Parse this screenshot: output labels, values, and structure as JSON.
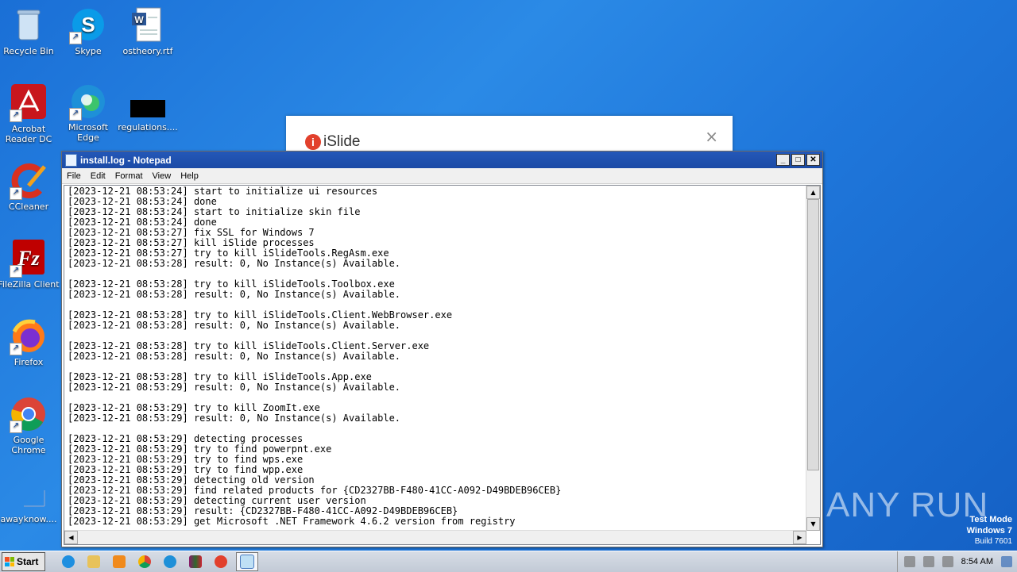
{
  "desktop": {
    "icons": [
      {
        "label": "Recycle Bin",
        "icon": "recycle-bin-icon"
      },
      {
        "label": "Skype",
        "icon": "skype-icon"
      },
      {
        "label": "ostheory.rtf",
        "icon": "word-document-icon"
      },
      {
        "label": "Acrobat Reader DC",
        "icon": "acrobat-icon"
      },
      {
        "label": "Microsoft Edge",
        "icon": "edge-icon"
      },
      {
        "label": "regulations....",
        "icon": "file-icon"
      },
      {
        "label": "CCleaner",
        "icon": "ccleaner-icon"
      },
      {
        "label": "FileZilla Client",
        "icon": "filezilla-icon"
      },
      {
        "label": "Firefox",
        "icon": "firefox-icon"
      },
      {
        "label": "Google Chrome",
        "icon": "chrome-icon"
      },
      {
        "label": "awayknow....",
        "icon": "file-icon"
      }
    ]
  },
  "islide": {
    "title": "iSlide",
    "close": "×"
  },
  "notepad": {
    "title": "install.log - Notepad",
    "menu": [
      "File",
      "Edit",
      "Format",
      "View",
      "Help"
    ],
    "lines": [
      "[2023-12-21 08:53:24] start to initialize ui resources",
      "[2023-12-21 08:53:24] done",
      "[2023-12-21 08:53:24] start to initialize skin file",
      "[2023-12-21 08:53:24] done",
      "[2023-12-21 08:53:27] fix SSL for Windows 7",
      "[2023-12-21 08:53:27] kill iSlide processes",
      "[2023-12-21 08:53:27] try to kill iSlideTools.RegAsm.exe",
      "[2023-12-21 08:53:28] result: 0, No Instance(s) Available.",
      "",
      "[2023-12-21 08:53:28] try to kill iSlideTools.Toolbox.exe",
      "[2023-12-21 08:53:28] result: 0, No Instance(s) Available.",
      "",
      "[2023-12-21 08:53:28] try to kill iSlideTools.Client.WebBrowser.exe",
      "[2023-12-21 08:53:28] result: 0, No Instance(s) Available.",
      "",
      "[2023-12-21 08:53:28] try to kill iSlideTools.Client.Server.exe",
      "[2023-12-21 08:53:28] result: 0, No Instance(s) Available.",
      "",
      "[2023-12-21 08:53:28] try to kill iSlideTools.App.exe",
      "[2023-12-21 08:53:29] result: 0, No Instance(s) Available.",
      "",
      "[2023-12-21 08:53:29] try to kill ZoomIt.exe",
      "[2023-12-21 08:53:29] result: 0, No Instance(s) Available.",
      "",
      "[2023-12-21 08:53:29] detecting processes",
      "[2023-12-21 08:53:29] try to find powerpnt.exe",
      "[2023-12-21 08:53:29] try to find wps.exe",
      "[2023-12-21 08:53:29] try to find wpp.exe",
      "[2023-12-21 08:53:29] detecting old version",
      "[2023-12-21 08:53:29] find related products for {CD2327BB-F480-41CC-A092-D49BDEB96CEB}",
      "[2023-12-21 08:53:29] detecting current user version",
      "[2023-12-21 08:53:29] result: {CD2327BB-F480-41CC-A092-D49BDEB96CEB}",
      "[2023-12-21 08:53:29] get Microsoft .NET Framework 4.6.2 version from registry"
    ]
  },
  "watermark": {
    "text": "ANY RUN"
  },
  "testmode": {
    "line1": "Test Mode",
    "line2": "Windows 7",
    "line3": "Build 7601"
  },
  "taskbar": {
    "start_label": "Start",
    "apps": [
      "ie-icon",
      "explorer-icon",
      "media-player-icon",
      "chrome-icon",
      "edge-icon",
      "winrar-icon",
      "islide-icon",
      "notepad-icon"
    ],
    "clock": "8:54 AM"
  }
}
